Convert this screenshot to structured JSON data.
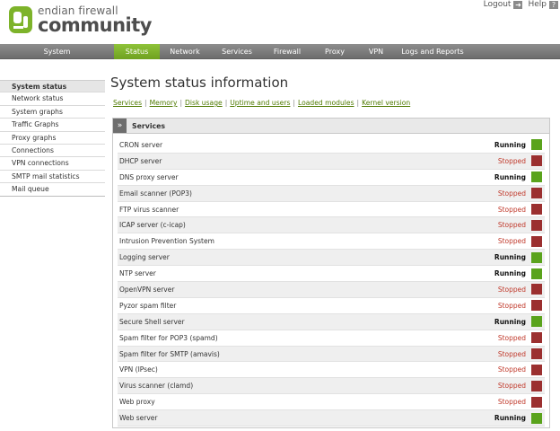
{
  "header": {
    "logo_line1": "endian firewall",
    "logo_line2": "community",
    "logout_label": "Logout",
    "help_label": "Help"
  },
  "nav": {
    "items": [
      {
        "label": "System",
        "active": false
      },
      {
        "label": "Status",
        "active": true
      },
      {
        "label": "Network",
        "active": false
      },
      {
        "label": "Services",
        "active": false
      },
      {
        "label": "Firewall",
        "active": false
      },
      {
        "label": "Proxy",
        "active": false
      },
      {
        "label": "VPN",
        "active": false
      },
      {
        "label": "Logs and Reports",
        "active": false
      }
    ]
  },
  "sidebar": {
    "items": [
      {
        "label": "System status",
        "active": true
      },
      {
        "label": "Network status",
        "active": false
      },
      {
        "label": "System graphs",
        "active": false
      },
      {
        "label": "Traffic Graphs",
        "active": false
      },
      {
        "label": "Proxy graphs",
        "active": false
      },
      {
        "label": "Connections",
        "active": false
      },
      {
        "label": "VPN connections",
        "active": false
      },
      {
        "label": "SMTP mail statistics",
        "active": false
      },
      {
        "label": "Mail queue",
        "active": false
      }
    ]
  },
  "main": {
    "title": "System status information",
    "sublinks": [
      "Services",
      "Memory",
      "Disk usage",
      "Uptime and users",
      "Loaded modules",
      "Kernel version"
    ],
    "panel": {
      "toggle_symbol": "»",
      "title": "Services",
      "rows": [
        {
          "name": "CRON server",
          "status": "Running"
        },
        {
          "name": "DHCP server",
          "status": "Stopped"
        },
        {
          "name": "DNS proxy server",
          "status": "Running"
        },
        {
          "name": "Email scanner (POP3)",
          "status": "Stopped"
        },
        {
          "name": "FTP virus scanner",
          "status": "Stopped"
        },
        {
          "name": "ICAP server (c-icap)",
          "status": "Stopped"
        },
        {
          "name": "Intrusion Prevention System",
          "status": "Stopped"
        },
        {
          "name": "Logging server",
          "status": "Running"
        },
        {
          "name": "NTP server",
          "status": "Running"
        },
        {
          "name": "OpenVPN server",
          "status": "Stopped"
        },
        {
          "name": "Pyzor spam filter",
          "status": "Stopped"
        },
        {
          "name": "Secure Shell server",
          "status": "Running"
        },
        {
          "name": "Spam filter for POP3 (spamd)",
          "status": "Stopped"
        },
        {
          "name": "Spam filter for SMTP (amavis)",
          "status": "Stopped"
        },
        {
          "name": "VPN (IPsec)",
          "status": "Stopped"
        },
        {
          "name": "Virus scanner (clamd)",
          "status": "Stopped"
        },
        {
          "name": "Web proxy",
          "status": "Stopped"
        },
        {
          "name": "Web server",
          "status": "Running"
        }
      ]
    }
  },
  "colors": {
    "accent_green": "#7db32a",
    "running_indicator": "#5aa31c",
    "stopped_indicator": "#9b2f2f",
    "nav_bg": "#7d7d7d"
  },
  "icons": {
    "logout": "logout-icon",
    "help": "help-icon"
  }
}
